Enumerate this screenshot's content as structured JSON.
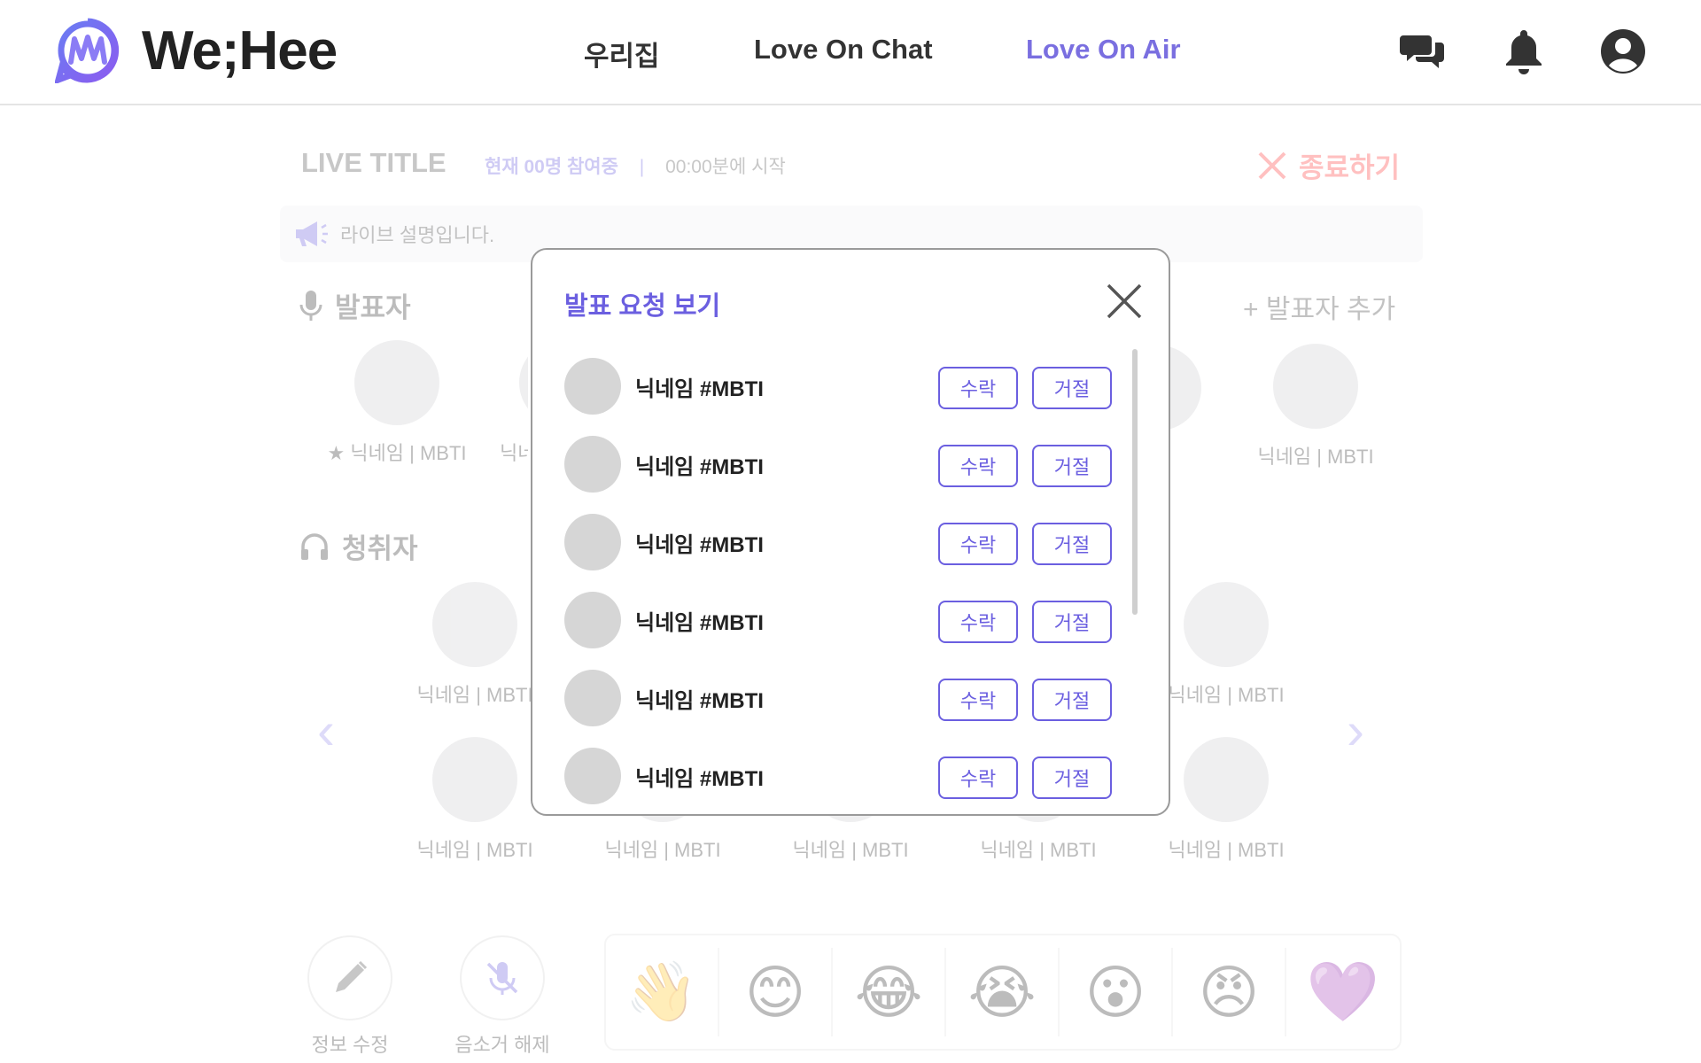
{
  "header": {
    "logo_text": "We;Hee",
    "nav": [
      "우리집",
      "Love On Chat",
      "Love On Air"
    ],
    "active_nav": "Love On Air",
    "icons": [
      "chat-icon",
      "bell-icon",
      "profile-icon"
    ]
  },
  "live": {
    "title": "LIVE TITLE",
    "participants": "현재 00명 참여중",
    "separator": "|",
    "start_time": "00:00분에 시작",
    "end_label": "종료하기",
    "description": "라이브 설명입니다."
  },
  "speakers": {
    "section_title": "발표자",
    "add_label": "+ 발표자 추가",
    "items": [
      {
        "label": "★ 닉네임 | MBTI"
      },
      {
        "label": "닉네임 | MBTI"
      },
      {
        "label": "닉네임 | MBTI"
      },
      {
        "label": "닉네임 | MBTI"
      }
    ]
  },
  "listeners": {
    "section_title": "청취자",
    "rows": [
      [
        "닉네임 | MBTI",
        "닉네임 | MBTI"
      ],
      [
        "닉네임 | MBTI",
        "닉네임 | MBTI",
        "닉네임 | MBTI",
        "닉네임 | MBTI",
        "닉네임 | MBTI"
      ]
    ]
  },
  "controls": {
    "edit_label": "정보 수정",
    "unmute_label": "음소거 해제"
  },
  "emojis": [
    "👋",
    "😊",
    "😂",
    "😭",
    "😮",
    "😠",
    "💜"
  ],
  "modal": {
    "title": "발표 요청 보기",
    "accept_label": "수락",
    "reject_label": "거절",
    "requests": [
      {
        "nickname": "닉네임 #MBTI"
      },
      {
        "nickname": "닉네임 #MBTI"
      },
      {
        "nickname": "닉네임 #MBTI"
      },
      {
        "nickname": "닉네임 #MBTI"
      },
      {
        "nickname": "닉네임 #MBTI"
      },
      {
        "nickname": "닉네임 #MBTI"
      }
    ]
  },
  "colors": {
    "accent": "#6b5fe0",
    "danger": "#ff3f3f",
    "avatar": "#d6d6d6"
  }
}
